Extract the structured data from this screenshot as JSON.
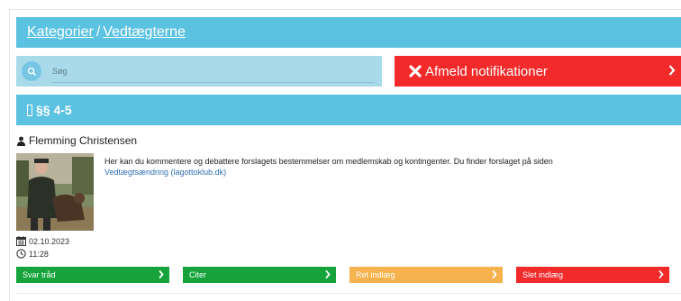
{
  "breadcrumb": {
    "category": "Kategorier",
    "separator": "/",
    "current": "Vedtægterne"
  },
  "search": {
    "placeholder": "Søg",
    "icon": "search-icon"
  },
  "unsubscribe": {
    "label": "Afmeld notifikationer",
    "icon": "x-icon"
  },
  "thread": {
    "title": "§§ 4-5"
  },
  "post": {
    "author": "Flemming Christensen",
    "text": "Her kan du kommentere og debattere forslagets bestemmelser om medlemskab og kontingenter. Du finder forslaget på siden ",
    "link": "Vedtægtsændring (lagottoklub.dk)",
    "date": "02.10.2023",
    "time": "11:28"
  },
  "actions": {
    "reply": "Svar tråd",
    "quote": "Citer",
    "edit": "Ret indlæg",
    "delete": "Slet indlæg"
  },
  "colors": {
    "header_blue": "#5bc2e2",
    "reply_green": "#16a33b",
    "edit_orange": "#f6b24d",
    "delete_red": "#f22a2a"
  }
}
